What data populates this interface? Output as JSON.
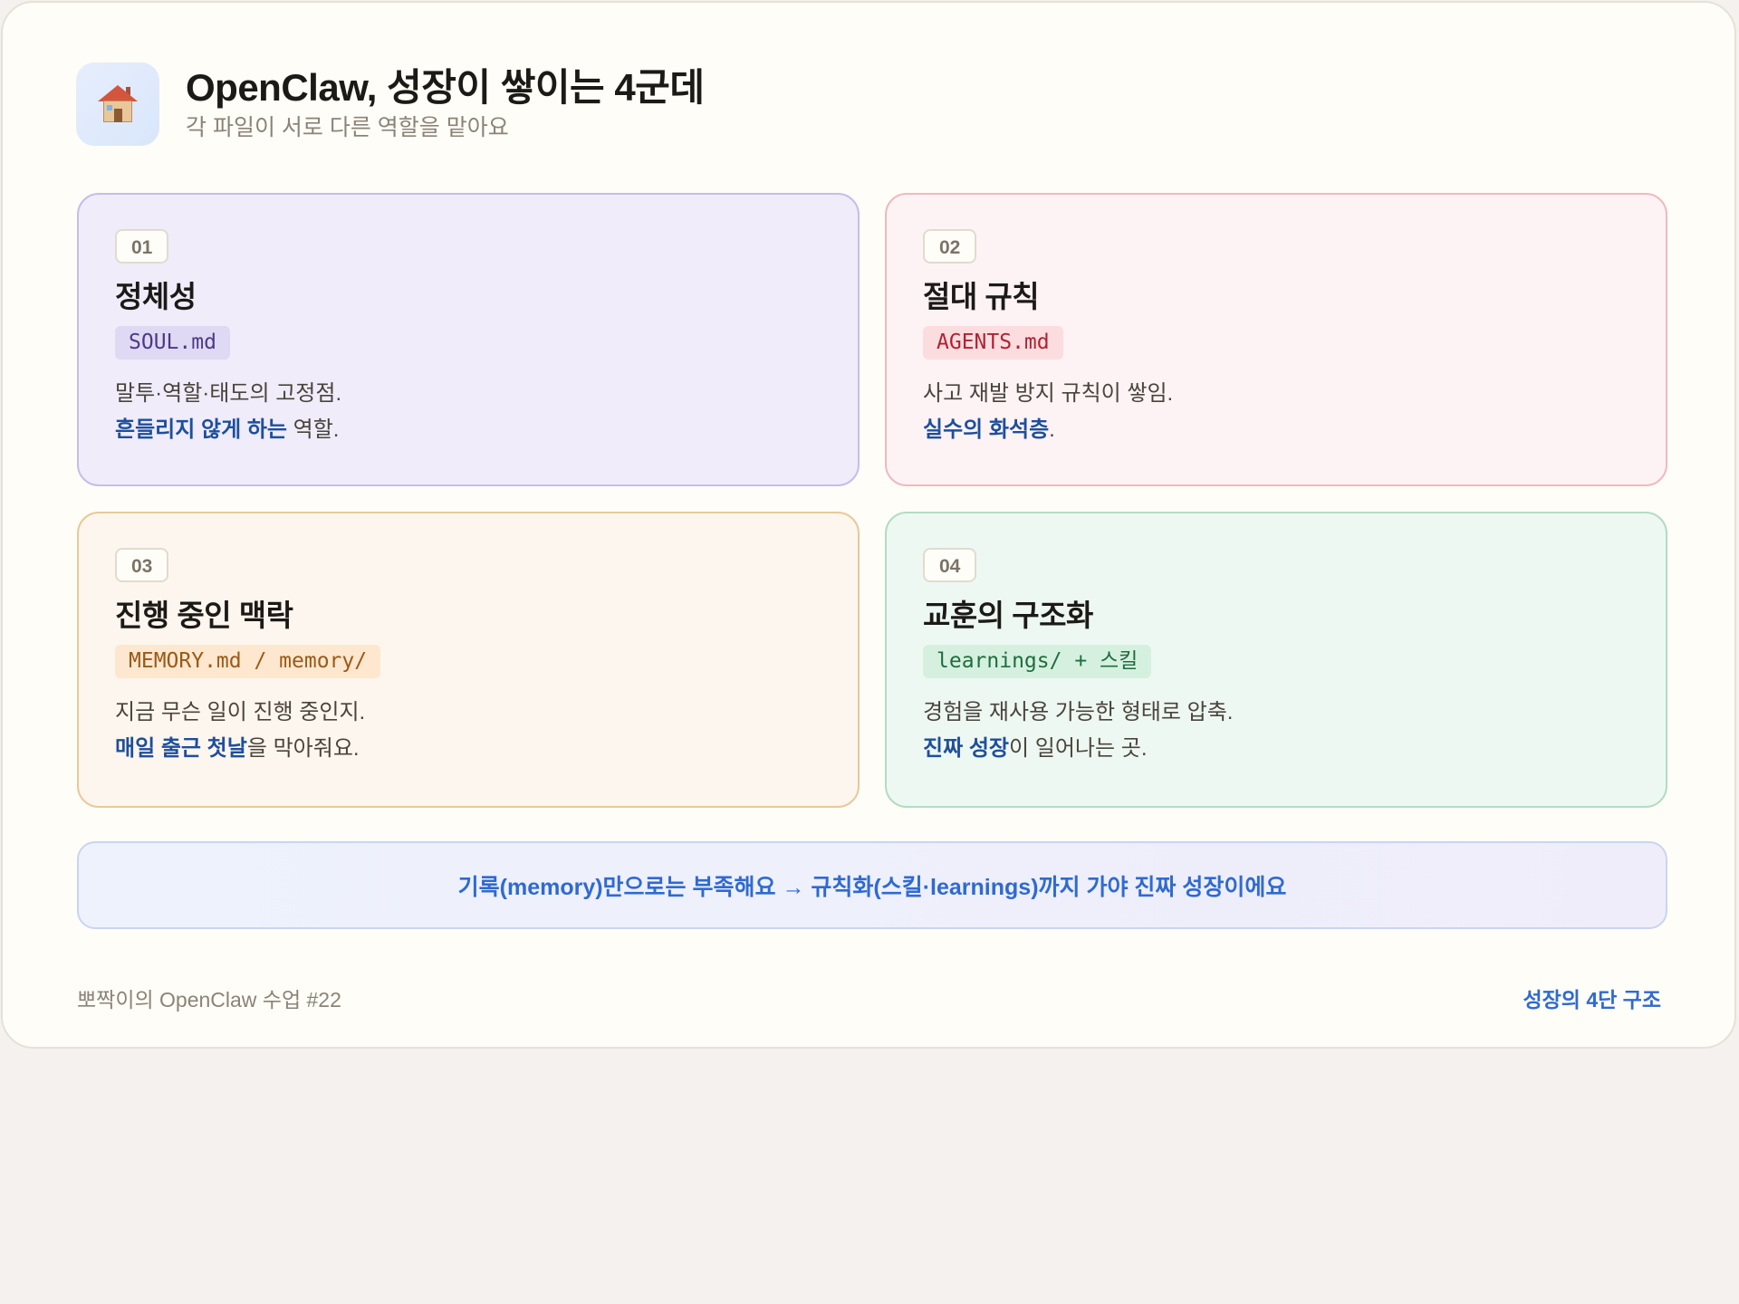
{
  "header": {
    "logo_icon": "house-icon",
    "title": "OpenClaw, 성장이 쌓이는 4군데",
    "subtitle": "각 파일이 서로 다른 역할을 맡아요"
  },
  "cards": [
    {
      "number": "01",
      "title": "정체성",
      "file": "SOUL.md",
      "line1": "말투·역할·태도의 고정점.",
      "line2_highlight": "흔들리지 않게 하는",
      "line2_rest": " 역할."
    },
    {
      "number": "02",
      "title": "절대 규칙",
      "file": "AGENTS.md",
      "line1": "사고 재발 방지 규칙이 쌓임.",
      "line2_highlight": "실수의 화석층",
      "line2_rest": "."
    },
    {
      "number": "03",
      "title": "진행 중인 맥락",
      "file": "MEMORY.md / memory/",
      "line1": "지금 무슨 일이 진행 중인지.",
      "line2_highlight": "매일 출근 첫날",
      "line2_rest": "을 막아줘요."
    },
    {
      "number": "04",
      "title": "교훈의 구조화",
      "file": "learnings/ + 스킬",
      "line1": "경험을 재사용 가능한 형태로 압축.",
      "line2_highlight": "진짜 성장",
      "line2_rest": "이 일어나는 곳."
    }
  ],
  "banner": {
    "text": "기록(memory)만으로는 부족해요 → 규칙화(스킬·learnings)까지 가야 진짜 성장이에요"
  },
  "footer": {
    "left": "뽀짝이의 OpenClaw 수업 #22",
    "right": "성장의 4단 구조"
  },
  "colors": {
    "accent_blue": "#2f6ad1",
    "highlight_navy": "#1d4f9c",
    "card1_bg": "#f0ecfa",
    "card2_bg": "#fdf3f4",
    "card3_bg": "#fdf6ee",
    "card4_bg": "#eef8f2"
  }
}
